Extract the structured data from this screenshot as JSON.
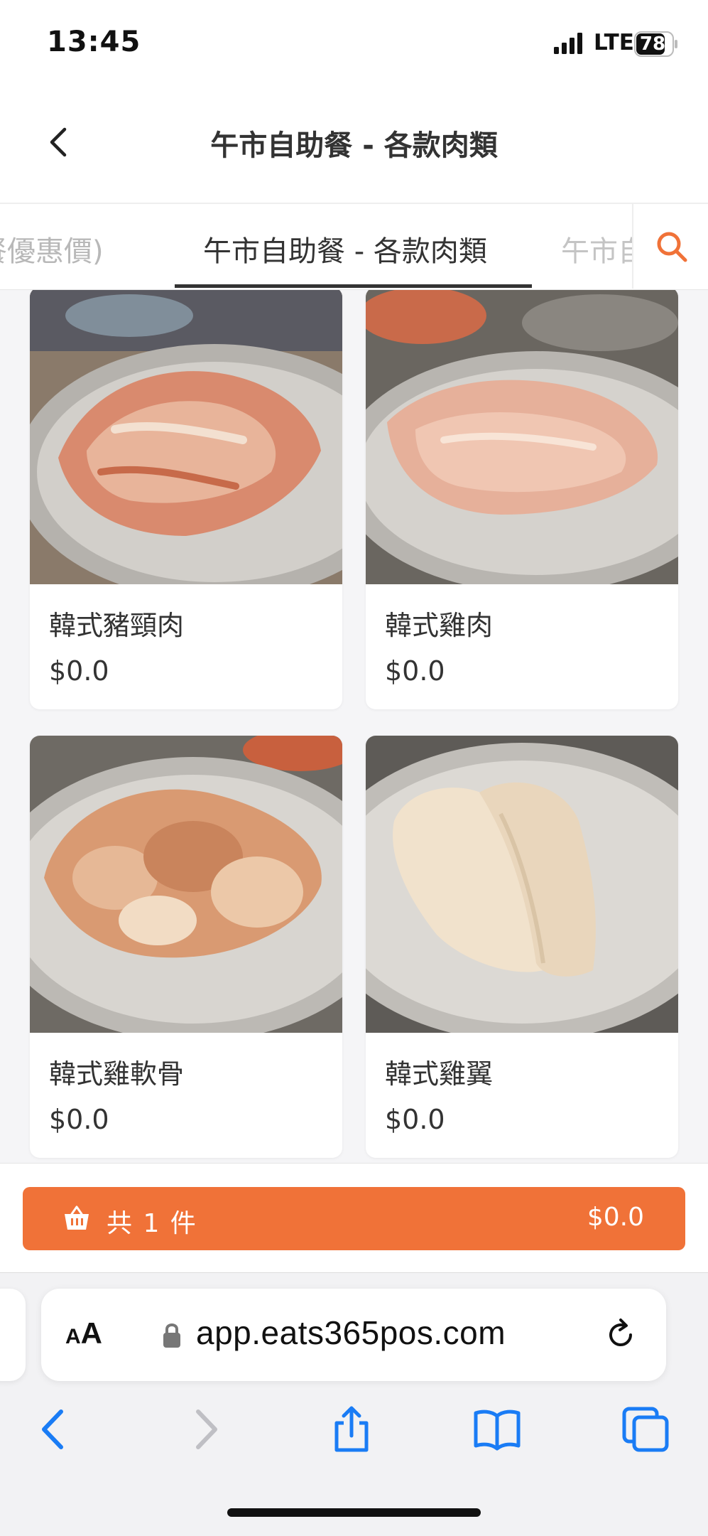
{
  "status_bar": {
    "time": "13:45",
    "network": "LTE",
    "battery": "78"
  },
  "header": {
    "back_icon": "chevron-left-icon",
    "title": "午市自助餐 - 各款肉類"
  },
  "category_tabs": {
    "items": [
      {
        "label": "餐優惠價)",
        "active": false
      },
      {
        "label": "午市自助餐 - 各款肉類",
        "active": true
      },
      {
        "label": "午市自",
        "active": false
      }
    ],
    "search_icon": "search-icon",
    "accent_color": "#f07238"
  },
  "products": [
    {
      "name": "韓式豬頸肉",
      "price": "$0.0"
    },
    {
      "name": "韓式雞肉",
      "price": "$0.0"
    },
    {
      "name": "韓式雞軟骨",
      "price": "$0.0"
    },
    {
      "name": "韓式雞翼",
      "price": "$0.0"
    }
  ],
  "cart": {
    "icon": "basket-icon",
    "count_label": "共 1 件",
    "total": "$0.0",
    "color": "#f07238"
  },
  "browser": {
    "reader_small": "A",
    "reader_big": "A",
    "url": "app.eats365pos.com",
    "toolbar": [
      "back-icon",
      "forward-icon",
      "share-icon",
      "bookmarks-icon",
      "tabs-icon"
    ],
    "accent_color": "#1a7cf5"
  }
}
